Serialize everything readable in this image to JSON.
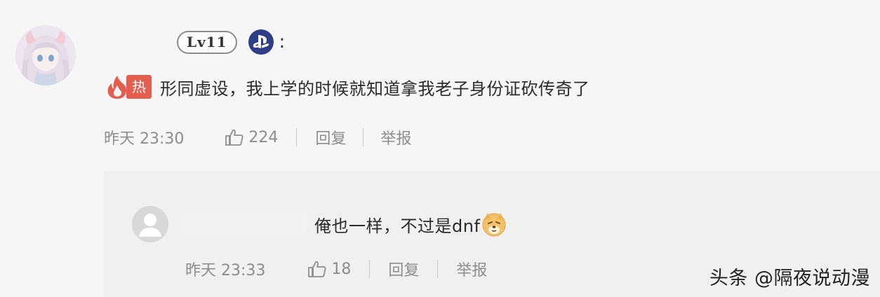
{
  "comment": {
    "level_badge": "Lv11",
    "colon": ":",
    "hot_label": "热",
    "text": "形同虚设，我上学的时候就知道拿我老子身份证砍传奇了",
    "time": "昨天 23:30",
    "likes": "224",
    "reply_label": "回复",
    "report_label": "举报"
  },
  "reply": {
    "text": "俺也一样，不过是dnf",
    "time": "昨天 23:33",
    "likes": "18",
    "reply_label": "回复",
    "report_label": "举报"
  },
  "watermark": "头条 @隔夜说动漫",
  "icons": {
    "platform": "playstation-icon",
    "hot": "flame-icon",
    "like": "thumbs-up-icon",
    "emoji": "dog-emoji-icon"
  },
  "colors": {
    "hot": "#e45d4f",
    "playstation": "#2e3e86",
    "muted_text": "#8d8d8d"
  }
}
